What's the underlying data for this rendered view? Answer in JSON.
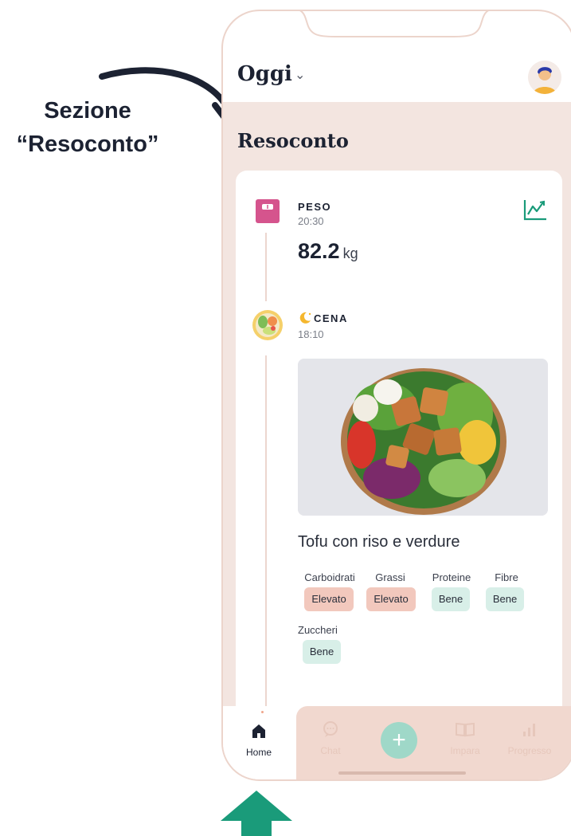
{
  "annotation": {
    "line1": "Sezione",
    "line2": "“Resoconto”"
  },
  "header": {
    "date_label": "Oggi",
    "chevron": "⌄"
  },
  "section": {
    "title": "Resoconto"
  },
  "weight_entry": {
    "title": "PESO",
    "time": "20:30",
    "value": "82.2",
    "unit": "kg"
  },
  "meal_entry": {
    "title": "CENA",
    "time": "18:10",
    "meal_name": "Tofu con riso e verdure",
    "nutrients": [
      {
        "label": "Carboidrati",
        "status": "Elevato",
        "level": "high"
      },
      {
        "label": "Grassi",
        "status": "Elevato",
        "level": "high"
      },
      {
        "label": "Proteine",
        "status": "Bene",
        "level": "good"
      },
      {
        "label": "Fibre",
        "status": "Bene",
        "level": "good"
      },
      {
        "label": "Zuccheri",
        "status": "Bene",
        "level": "good"
      }
    ]
  },
  "bottom_nav": {
    "items": [
      {
        "label": "Home",
        "icon": "home-icon",
        "active": true
      },
      {
        "label": "Chat",
        "icon": "chat-icon",
        "active": false
      },
      {
        "label": "",
        "icon": "plus-icon",
        "active": false
      },
      {
        "label": "Impara",
        "icon": "book-icon",
        "active": false
      },
      {
        "label": "Progresso",
        "icon": "chart-bars-icon",
        "active": false
      }
    ]
  },
  "colors": {
    "background": "#f3e5e0",
    "high_badge": "#f2c8bd",
    "good_badge": "#d8efe8",
    "accent_green": "#1a9b7a",
    "arrow_dark": "#1c2232"
  }
}
